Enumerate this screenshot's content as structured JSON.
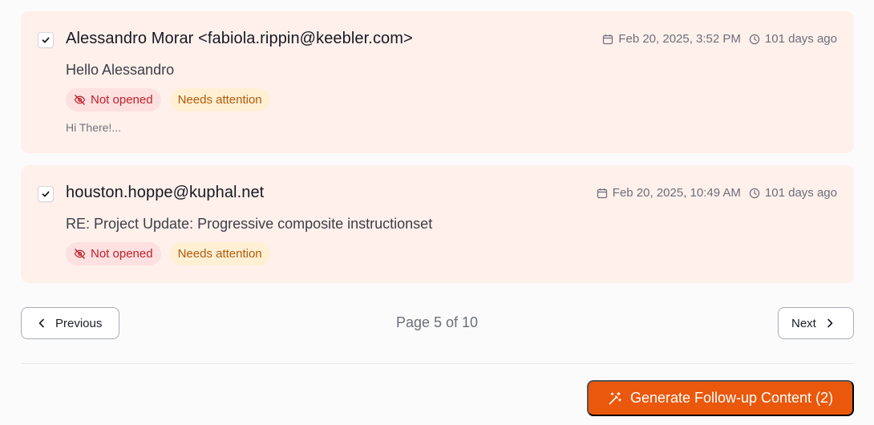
{
  "emails": [
    {
      "checked": true,
      "sender": "Alessandro Morar <fabiola.rippin@keebler.com>",
      "date": "Feb 20, 2025, 3:52 PM",
      "age": "101 days ago",
      "subject": "Hello Alessandro",
      "badges": {
        "status": "Not opened",
        "priority": "Needs attention"
      },
      "preview": "Hi There!..."
    },
    {
      "checked": true,
      "sender": "houston.hoppe@kuphal.net",
      "date": "Feb 20, 2025, 10:49 AM",
      "age": "101 days ago",
      "subject": "RE: Project Update: Progressive composite instructionset",
      "badges": {
        "status": "Not opened",
        "priority": "Needs attention"
      }
    }
  ],
  "pagination": {
    "previous_label": "Previous",
    "next_label": "Next",
    "page_text": "Page 5 of 10"
  },
  "actions": {
    "generate_label": "Generate Follow-up Content (2)"
  },
  "colors": {
    "card_bg": "#fff0eb",
    "accent": "#ea580c",
    "badge_red": "#c0202a",
    "badge_amber": "#b15a0a"
  },
  "icons": {
    "checkbox": "checkmark-icon",
    "date": "calendar-icon",
    "age": "clock-icon",
    "not_opened": "eye-off-icon",
    "previous": "chevron-left-icon",
    "next": "chevron-right-icon",
    "generate": "magic-wand-icon"
  }
}
